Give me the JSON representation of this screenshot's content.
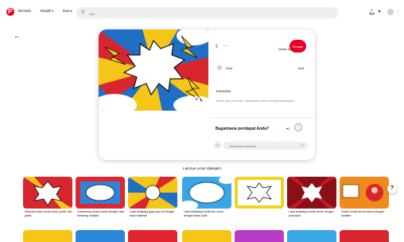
{
  "topbar": {
    "nav_home": "Beranda",
    "nav_explore": "Jelajahi",
    "nav_create": "Buat",
    "search_placeholder": "Cari"
  },
  "pin": {
    "board_label": "Duvar kağıtları",
    "save_label": "Simpan",
    "user_name": "Ama",
    "follow_label": "Ikuti",
    "comments_title": "Komentar",
    "comments_empty": "Belum ada komentar! Tambahkan untuk memulai percakapan.",
    "reaction_question": "Bagaimana pendapat Anda?",
    "reaction_count": "1",
    "comment_placeholder": "Tambahkan komentar"
  },
  "more": {
    "title": "Lainnya untuk dijelajahi",
    "items": [
      {
        "caption": "Dekorasi buku komik untuk poster dan grafis"
      },
      {
        "caption": "Gelembung bicara komik dengan latar belakang ledakan"
      },
      {
        "caption": "Latar belakang gaya pop art dengan sinar matahari"
      },
      {
        "caption": "Latar belakang komik biru cerah dengan awan putih"
      },
      {
        "caption": ""
      },
      {
        "caption": "Latar belakang komik merah dengan pola sinar"
      },
      {
        "caption": "Poster komik penuh warna dengan karakter"
      }
    ]
  },
  "colors": {
    "brand": "#e60023",
    "comic_red": "#d8262e",
    "comic_blue": "#1f6fc4",
    "comic_yellow": "#f5c518"
  }
}
